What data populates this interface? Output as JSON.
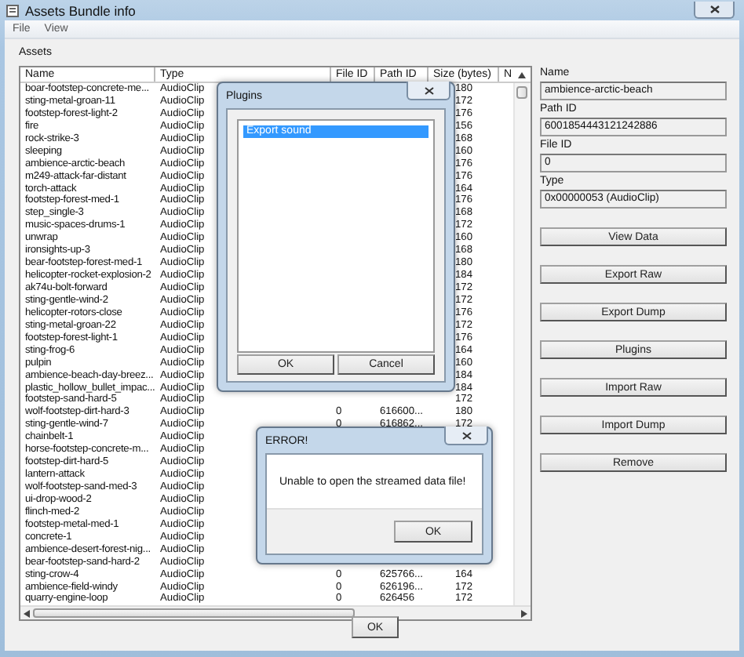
{
  "window": {
    "title": "Assets Bundle info"
  },
  "menu": [
    "File",
    "View"
  ],
  "assets_label": "Assets",
  "table": {
    "columns": [
      "Name",
      "Type",
      "File ID",
      "Path ID",
      "Size (bytes)",
      "N"
    ],
    "rows": [
      {
        "name": "boar-footstep-concrete-me...",
        "type": "AudioClip",
        "size": "180"
      },
      {
        "name": "sting-metal-groan-11",
        "type": "AudioClip",
        "size": "172"
      },
      {
        "name": "footstep-forest-light-2",
        "type": "AudioClip",
        "size": "176"
      },
      {
        "name": "fire",
        "type": "AudioClip",
        "size": "156"
      },
      {
        "name": "rock-strike-3",
        "type": "AudioClip",
        "size": "168"
      },
      {
        "name": "sleeping",
        "type": "AudioClip",
        "size": "160"
      },
      {
        "name": "ambience-arctic-beach",
        "type": "AudioClip",
        "size": "176"
      },
      {
        "name": "m249-attack-far-distant",
        "type": "AudioClip",
        "size": "176"
      },
      {
        "name": "torch-attack",
        "type": "AudioClip",
        "size": "164"
      },
      {
        "name": "footstep-forest-med-1",
        "type": "AudioClip",
        "size": "176"
      },
      {
        "name": "step_single-3",
        "type": "AudioClip",
        "size": "168"
      },
      {
        "name": "music-spaces-drums-1",
        "type": "AudioClip",
        "size": "172"
      },
      {
        "name": "unwrap",
        "type": "AudioClip",
        "size": "160"
      },
      {
        "name": "ironsights-up-3",
        "type": "AudioClip",
        "size": "168"
      },
      {
        "name": "bear-footstep-forest-med-1",
        "type": "AudioClip",
        "size": "180"
      },
      {
        "name": "helicopter-rocket-explosion-2",
        "type": "AudioClip",
        "size": "184"
      },
      {
        "name": "ak74u-bolt-forward",
        "type": "AudioClip",
        "size": "172"
      },
      {
        "name": "sting-gentle-wind-2",
        "type": "AudioClip",
        "size": "172"
      },
      {
        "name": "helicopter-rotors-close",
        "type": "AudioClip",
        "size": "176"
      },
      {
        "name": "sting-metal-groan-22",
        "type": "AudioClip",
        "size": "172"
      },
      {
        "name": "footstep-forest-light-1",
        "type": "AudioClip",
        "size": "176"
      },
      {
        "name": "sting-frog-6",
        "type": "AudioClip",
        "size": "164"
      },
      {
        "name": "pulpin",
        "type": "AudioClip",
        "size": "160"
      },
      {
        "name": "ambience-beach-day-breez...",
        "type": "AudioClip",
        "size": "184"
      },
      {
        "name": "plastic_hollow_bullet_impac...",
        "type": "AudioClip",
        "size": "184"
      },
      {
        "name": "footstep-sand-hard-5",
        "type": "AudioClip",
        "size": "172"
      },
      {
        "name": "wolf-footstep-dirt-hard-3",
        "type": "AudioClip",
        "file_id": "0",
        "path_id": "616600...",
        "size": "180"
      },
      {
        "name": "sting-gentle-wind-7",
        "type": "AudioClip",
        "file_id": "0",
        "path_id": "616862...",
        "size": "172"
      },
      {
        "name": "chainbelt-1",
        "type": "AudioClip"
      },
      {
        "name": "horse-footstep-concrete-m...",
        "type": "AudioClip"
      },
      {
        "name": "footstep-dirt-hard-5",
        "type": "AudioClip"
      },
      {
        "name": "lantern-attack",
        "type": "AudioClip"
      },
      {
        "name": "wolf-footstep-sand-med-3",
        "type": "AudioClip"
      },
      {
        "name": "ui-drop-wood-2",
        "type": "AudioClip"
      },
      {
        "name": "flinch-med-2",
        "type": "AudioClip"
      },
      {
        "name": "footstep-metal-med-1",
        "type": "AudioClip"
      },
      {
        "name": "concrete-1",
        "type": "AudioClip"
      },
      {
        "name": "ambience-desert-forest-nig...",
        "type": "AudioClip"
      },
      {
        "name": "bear-footstep-sand-hard-2",
        "type": "AudioClip"
      },
      {
        "name": "sting-crow-4",
        "type": "AudioClip",
        "file_id": "0",
        "path_id": "625766...",
        "size": "164"
      },
      {
        "name": "ambience-field-windy",
        "type": "AudioClip",
        "file_id": "0",
        "path_id": "626196...",
        "size": "172"
      },
      {
        "name": "quarry-engine-loop",
        "type": "AudioClip",
        "file_id": "0",
        "path_id": "626456",
        "size": "172"
      }
    ]
  },
  "details": {
    "fields": [
      {
        "label": "Name",
        "value": "ambience-arctic-beach"
      },
      {
        "label": "Path ID",
        "value": "6001854443121242886"
      },
      {
        "label": "File ID",
        "value": "0"
      },
      {
        "label": "Type",
        "value": "0x00000053 (AudioClip)"
      }
    ],
    "buttons": [
      "View Data",
      "Export Raw",
      "Export Dump",
      "Plugins",
      "Import Raw",
      "Import Dump",
      "Remove"
    ]
  },
  "ok_button": "OK",
  "plugins_dialog": {
    "title": "Plugins",
    "items": [
      {
        "label": "Export sound",
        "selected": true
      }
    ],
    "buttons": [
      "OK",
      "Cancel"
    ]
  },
  "error_dialog": {
    "title": "ERROR!",
    "message": "Unable to open the streamed data file!",
    "button": "OK"
  }
}
